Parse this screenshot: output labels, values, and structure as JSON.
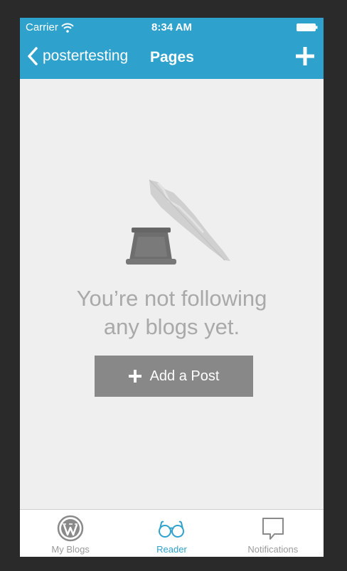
{
  "status_bar": {
    "carrier": "Carrier",
    "time": "8:34 AM"
  },
  "nav": {
    "back_label": "postertesting",
    "title": "Pages",
    "add_icon": "plus-icon"
  },
  "empty_state": {
    "message": "You’re not following\nany blogs yet.",
    "button_label": "Add a Post",
    "illustration": "inkwell-and-quill"
  },
  "tabs": [
    {
      "label": "My Blogs",
      "icon": "wordpress-icon",
      "active": false
    },
    {
      "label": "Reader",
      "icon": "glasses-icon",
      "active": true
    },
    {
      "label": "Notifications",
      "icon": "speech-bubble-icon",
      "active": false
    }
  ],
  "colors": {
    "accent": "#2ea2cc",
    "background": "#efefef",
    "button": "#888888",
    "muted_text": "#a9a9a9",
    "inactive_tab": "#9b9b9b"
  }
}
